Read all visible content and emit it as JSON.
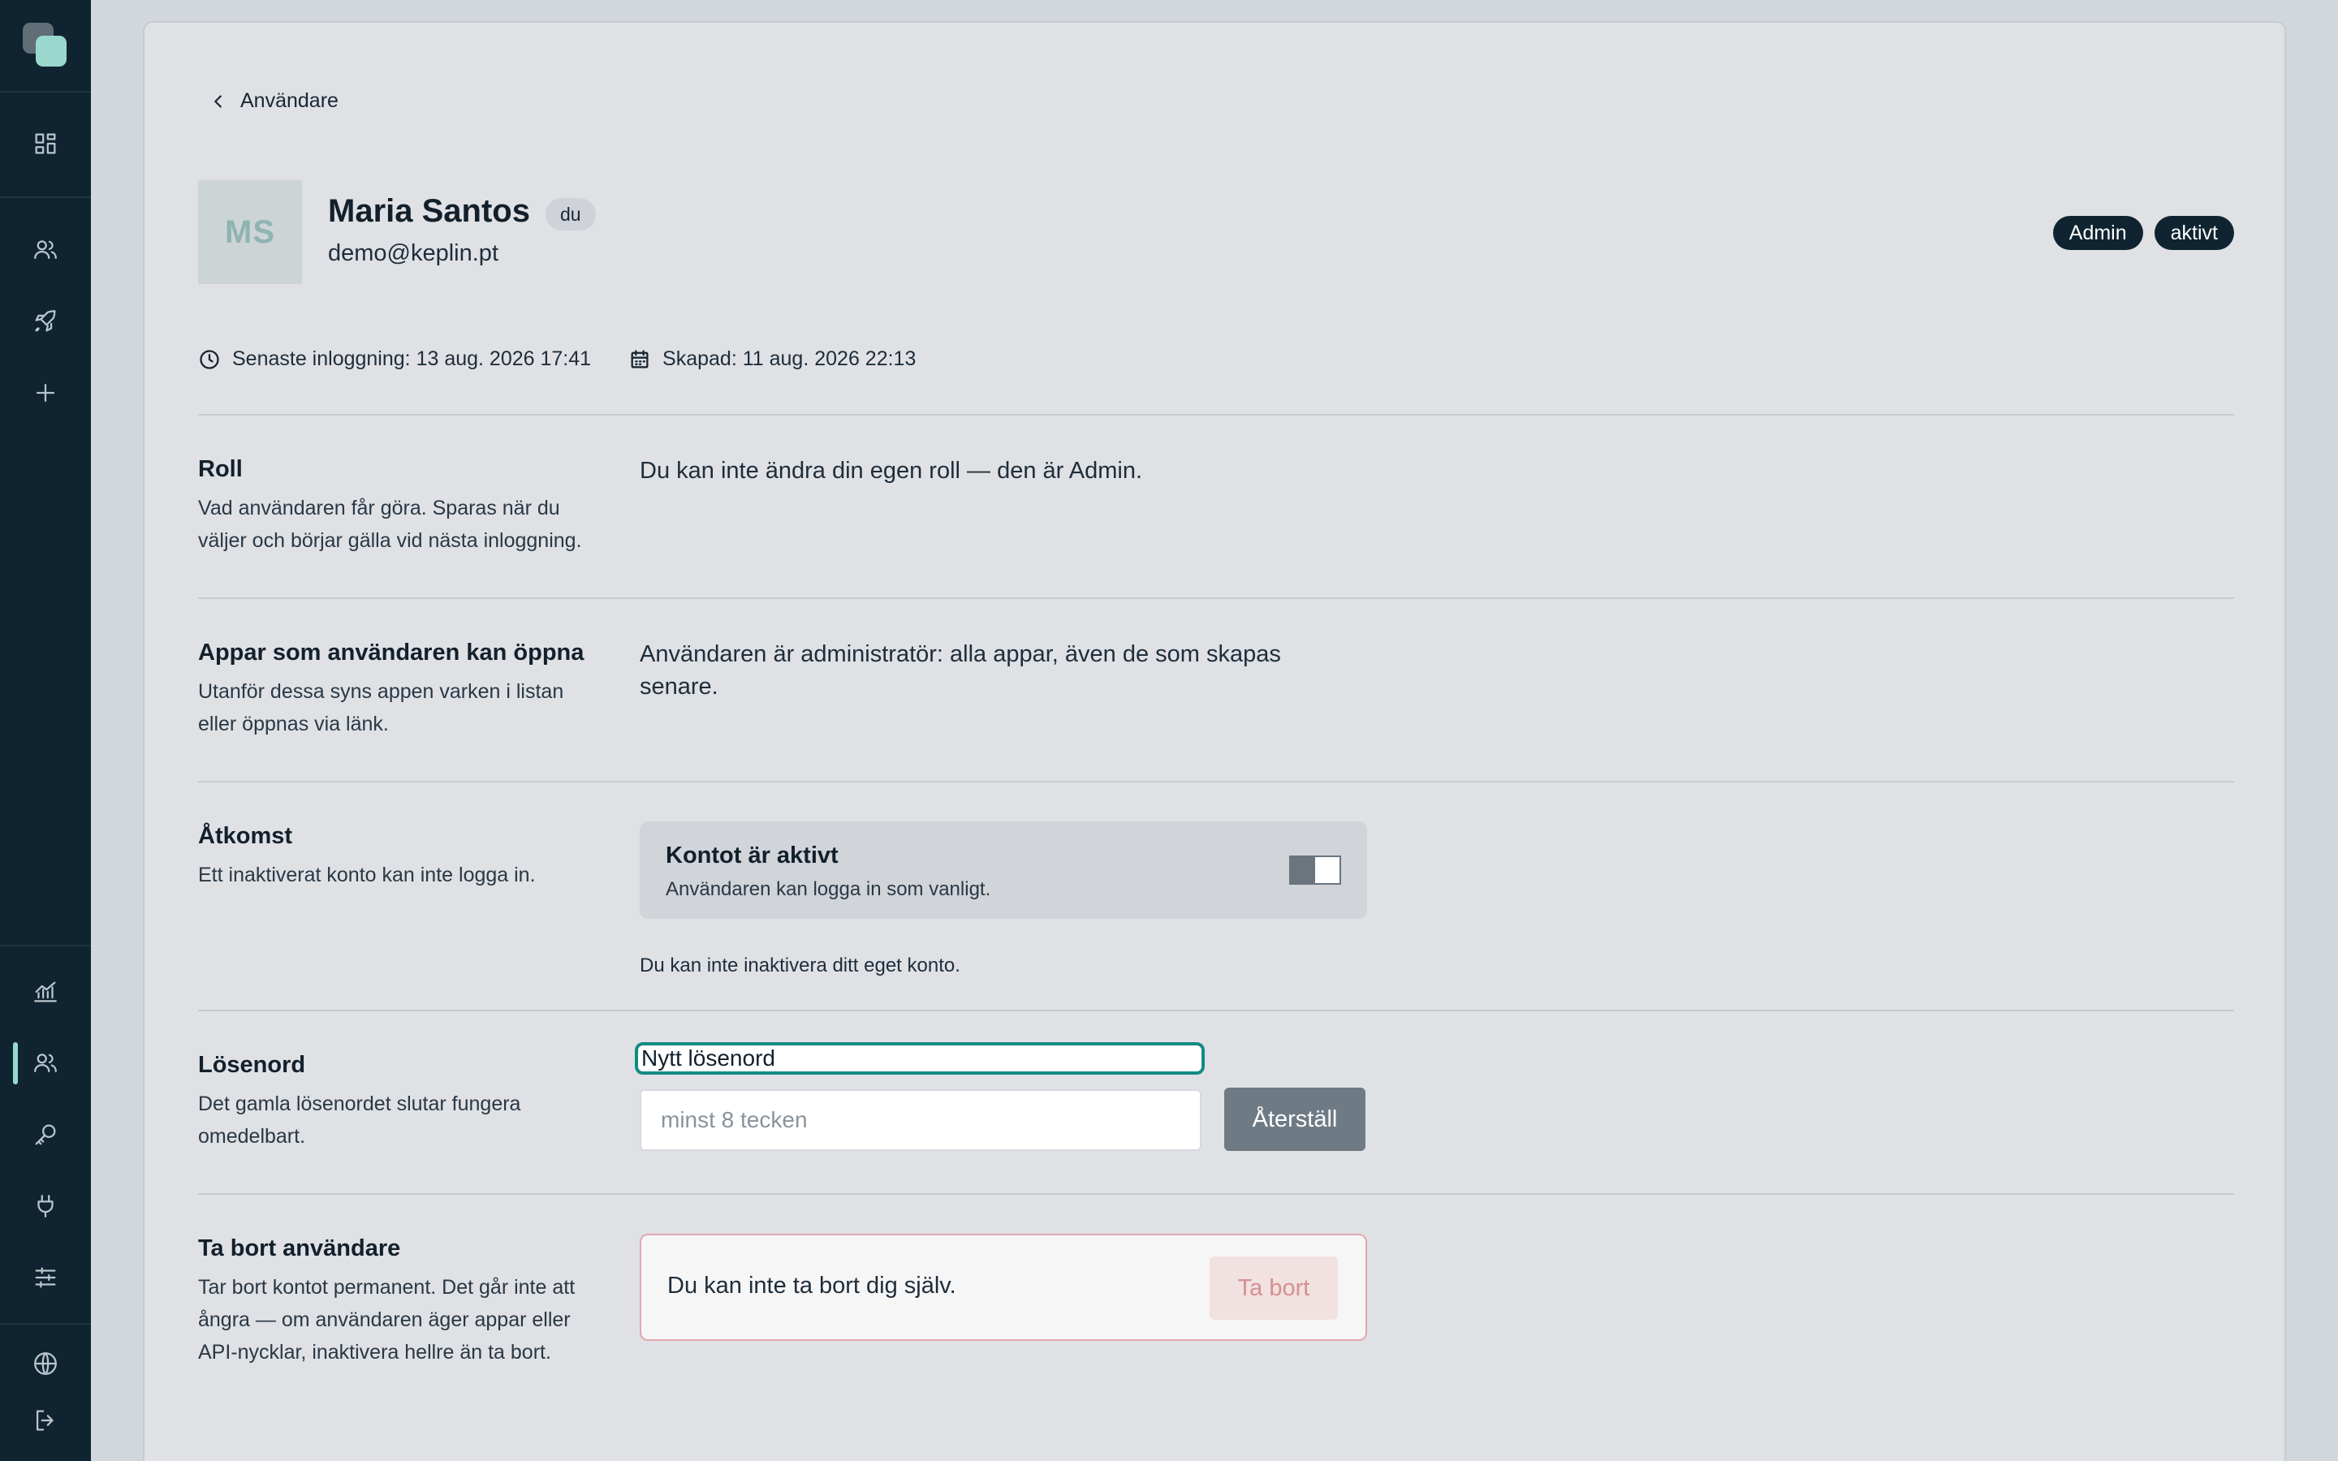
{
  "nav": {
    "top_items": [
      {
        "id": "dashboard",
        "icon": "dashboard-grid-icon"
      },
      {
        "id": "users",
        "icon": "users-icon"
      },
      {
        "id": "launch",
        "icon": "rocket-icon"
      },
      {
        "id": "add",
        "icon": "plus-icon"
      }
    ],
    "bottom_items": [
      {
        "id": "analytics",
        "icon": "chart-icon"
      },
      {
        "id": "users",
        "icon": "users-icon",
        "active": true
      },
      {
        "id": "keys",
        "icon": "key-icon"
      },
      {
        "id": "integrations",
        "icon": "plug-icon"
      },
      {
        "id": "settings",
        "icon": "sliders-icon"
      },
      {
        "id": "language",
        "icon": "globe-icon"
      },
      {
        "id": "logout",
        "icon": "logout-icon"
      }
    ],
    "accent_color": "#9ad8cd"
  },
  "breadcrumb": {
    "back_label": "Användare"
  },
  "user": {
    "initials": "MS",
    "name": "Maria Santos",
    "self_badge": "du",
    "email": "demo@keplin.pt",
    "role_badge": "Admin",
    "status_badge": "aktivt",
    "last_login": "Senaste inloggning: 13 aug. 2026 17:41",
    "created": "Skapad: 11 aug. 2026 22:13"
  },
  "sections": {
    "role": {
      "title": "Roll",
      "description": "Vad användaren får göra. Sparas när du väljer och börjar gälla vid nästa inloggning.",
      "content": "Du kan inte ändra din egen roll — den är Admin."
    },
    "apps": {
      "title": "Appar som användaren kan öppna",
      "description": "Utanför dessa syns appen varken i listan eller öppnas via länk.",
      "content": "Användaren är administratör: alla appar, även de som skapas senare."
    },
    "access": {
      "title": "Åtkomst",
      "description": "Ett inaktiverat konto kan inte logga in.",
      "toggle_title": "Kontot är aktivt",
      "toggle_subtitle": "Användaren kan logga in som vanligt.",
      "toggle_on": true,
      "note": "Du kan inte inaktivera ditt eget konto."
    },
    "password": {
      "title": "Lösenord",
      "description": "Det gamla lösenordet slutar fungera omedelbart.",
      "field_label": "Nytt lösenord",
      "placeholder": "minst 8 tecken",
      "value": "",
      "button": "Återställ",
      "focus_color": "#128b82"
    },
    "delete": {
      "title": "Ta bort användare",
      "description": "Tar bort kontot permanent. Det går inte att ångra — om användaren äger appar eller API-nycklar, inaktivera hellre än ta bort.",
      "message": "Du kan inte ta bort dig själv.",
      "button": "Ta bort",
      "danger_color": "#e3a8ac"
    }
  }
}
